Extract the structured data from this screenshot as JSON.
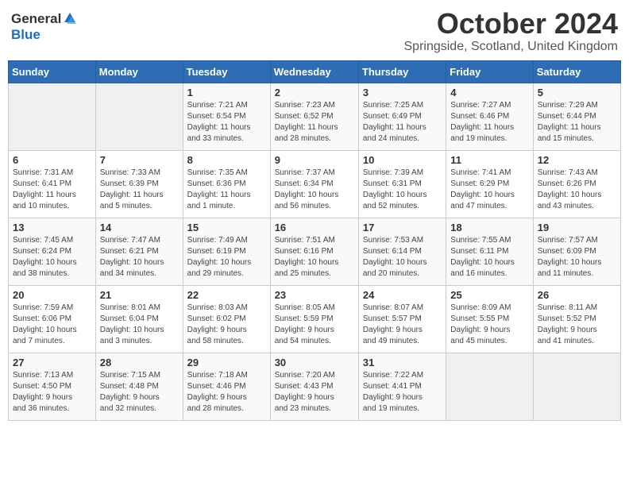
{
  "header": {
    "logo_general": "General",
    "logo_blue": "Blue",
    "month": "October 2024",
    "location": "Springside, Scotland, United Kingdom"
  },
  "calendar": {
    "days_of_week": [
      "Sunday",
      "Monday",
      "Tuesday",
      "Wednesday",
      "Thursday",
      "Friday",
      "Saturday"
    ],
    "weeks": [
      [
        {
          "day": "",
          "info": ""
        },
        {
          "day": "",
          "info": ""
        },
        {
          "day": "1",
          "info": "Sunrise: 7:21 AM\nSunset: 6:54 PM\nDaylight: 11 hours\nand 33 minutes."
        },
        {
          "day": "2",
          "info": "Sunrise: 7:23 AM\nSunset: 6:52 PM\nDaylight: 11 hours\nand 28 minutes."
        },
        {
          "day": "3",
          "info": "Sunrise: 7:25 AM\nSunset: 6:49 PM\nDaylight: 11 hours\nand 24 minutes."
        },
        {
          "day": "4",
          "info": "Sunrise: 7:27 AM\nSunset: 6:46 PM\nDaylight: 11 hours\nand 19 minutes."
        },
        {
          "day": "5",
          "info": "Sunrise: 7:29 AM\nSunset: 6:44 PM\nDaylight: 11 hours\nand 15 minutes."
        }
      ],
      [
        {
          "day": "6",
          "info": "Sunrise: 7:31 AM\nSunset: 6:41 PM\nDaylight: 11 hours\nand 10 minutes."
        },
        {
          "day": "7",
          "info": "Sunrise: 7:33 AM\nSunset: 6:39 PM\nDaylight: 11 hours\nand 5 minutes."
        },
        {
          "day": "8",
          "info": "Sunrise: 7:35 AM\nSunset: 6:36 PM\nDaylight: 11 hours\nand 1 minute."
        },
        {
          "day": "9",
          "info": "Sunrise: 7:37 AM\nSunset: 6:34 PM\nDaylight: 10 hours\nand 56 minutes."
        },
        {
          "day": "10",
          "info": "Sunrise: 7:39 AM\nSunset: 6:31 PM\nDaylight: 10 hours\nand 52 minutes."
        },
        {
          "day": "11",
          "info": "Sunrise: 7:41 AM\nSunset: 6:29 PM\nDaylight: 10 hours\nand 47 minutes."
        },
        {
          "day": "12",
          "info": "Sunrise: 7:43 AM\nSunset: 6:26 PM\nDaylight: 10 hours\nand 43 minutes."
        }
      ],
      [
        {
          "day": "13",
          "info": "Sunrise: 7:45 AM\nSunset: 6:24 PM\nDaylight: 10 hours\nand 38 minutes."
        },
        {
          "day": "14",
          "info": "Sunrise: 7:47 AM\nSunset: 6:21 PM\nDaylight: 10 hours\nand 34 minutes."
        },
        {
          "day": "15",
          "info": "Sunrise: 7:49 AM\nSunset: 6:19 PM\nDaylight: 10 hours\nand 29 minutes."
        },
        {
          "day": "16",
          "info": "Sunrise: 7:51 AM\nSunset: 6:16 PM\nDaylight: 10 hours\nand 25 minutes."
        },
        {
          "day": "17",
          "info": "Sunrise: 7:53 AM\nSunset: 6:14 PM\nDaylight: 10 hours\nand 20 minutes."
        },
        {
          "day": "18",
          "info": "Sunrise: 7:55 AM\nSunset: 6:11 PM\nDaylight: 10 hours\nand 16 minutes."
        },
        {
          "day": "19",
          "info": "Sunrise: 7:57 AM\nSunset: 6:09 PM\nDaylight: 10 hours\nand 11 minutes."
        }
      ],
      [
        {
          "day": "20",
          "info": "Sunrise: 7:59 AM\nSunset: 6:06 PM\nDaylight: 10 hours\nand 7 minutes."
        },
        {
          "day": "21",
          "info": "Sunrise: 8:01 AM\nSunset: 6:04 PM\nDaylight: 10 hours\nand 3 minutes."
        },
        {
          "day": "22",
          "info": "Sunrise: 8:03 AM\nSunset: 6:02 PM\nDaylight: 9 hours\nand 58 minutes."
        },
        {
          "day": "23",
          "info": "Sunrise: 8:05 AM\nSunset: 5:59 PM\nDaylight: 9 hours\nand 54 minutes."
        },
        {
          "day": "24",
          "info": "Sunrise: 8:07 AM\nSunset: 5:57 PM\nDaylight: 9 hours\nand 49 minutes."
        },
        {
          "day": "25",
          "info": "Sunrise: 8:09 AM\nSunset: 5:55 PM\nDaylight: 9 hours\nand 45 minutes."
        },
        {
          "day": "26",
          "info": "Sunrise: 8:11 AM\nSunset: 5:52 PM\nDaylight: 9 hours\nand 41 minutes."
        }
      ],
      [
        {
          "day": "27",
          "info": "Sunrise: 7:13 AM\nSunset: 4:50 PM\nDaylight: 9 hours\nand 36 minutes."
        },
        {
          "day": "28",
          "info": "Sunrise: 7:15 AM\nSunset: 4:48 PM\nDaylight: 9 hours\nand 32 minutes."
        },
        {
          "day": "29",
          "info": "Sunrise: 7:18 AM\nSunset: 4:46 PM\nDaylight: 9 hours\nand 28 minutes."
        },
        {
          "day": "30",
          "info": "Sunrise: 7:20 AM\nSunset: 4:43 PM\nDaylight: 9 hours\nand 23 minutes."
        },
        {
          "day": "31",
          "info": "Sunrise: 7:22 AM\nSunset: 4:41 PM\nDaylight: 9 hours\nand 19 minutes."
        },
        {
          "day": "",
          "info": ""
        },
        {
          "day": "",
          "info": ""
        }
      ]
    ]
  }
}
